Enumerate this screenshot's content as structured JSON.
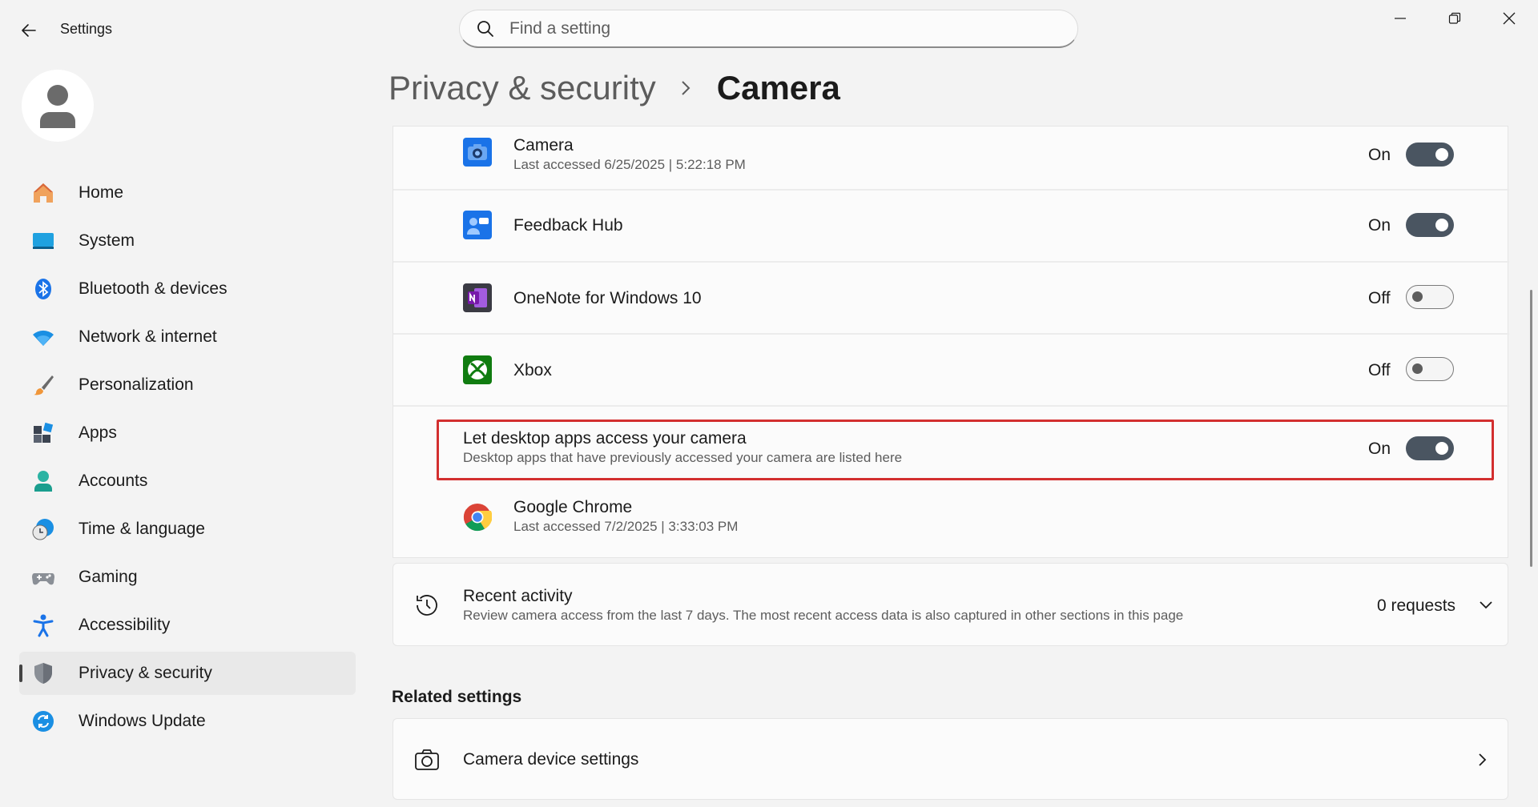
{
  "window": {
    "title": "Settings"
  },
  "search": {
    "placeholder": "Find a setting"
  },
  "sidebar": {
    "items": [
      {
        "label": "Home",
        "icon": "home-icon"
      },
      {
        "label": "System",
        "icon": "system-icon"
      },
      {
        "label": "Bluetooth & devices",
        "icon": "bluetooth-icon"
      },
      {
        "label": "Network & internet",
        "icon": "wifi-icon"
      },
      {
        "label": "Personalization",
        "icon": "brush-icon"
      },
      {
        "label": "Apps",
        "icon": "apps-icon"
      },
      {
        "label": "Accounts",
        "icon": "accounts-icon"
      },
      {
        "label": "Time & language",
        "icon": "clock-globe-icon"
      },
      {
        "label": "Gaming",
        "icon": "gamepad-icon"
      },
      {
        "label": "Accessibility",
        "icon": "accessibility-icon"
      },
      {
        "label": "Privacy & security",
        "icon": "shield-icon",
        "selected": true
      },
      {
        "label": "Windows Update",
        "icon": "update-icon"
      }
    ]
  },
  "breadcrumb": {
    "parent": "Privacy & security",
    "current": "Camera"
  },
  "apps": {
    "camera": {
      "name": "Camera",
      "last_accessed": "Last accessed 6/25/2025  |  5:22:18 PM",
      "state": "On"
    },
    "feedback_hub": {
      "name": "Feedback Hub",
      "state": "On"
    },
    "onenote": {
      "name": "OneNote for Windows 10",
      "state": "Off"
    },
    "xbox": {
      "name": "Xbox",
      "state": "Off"
    }
  },
  "desktop_apps": {
    "title": "Let desktop apps access your camera",
    "description": "Desktop apps that have previously accessed your camera are listed here",
    "state": "On",
    "chrome": {
      "name": "Google Chrome",
      "last_accessed": "Last accessed 7/2/2025  |  3:33:03 PM"
    }
  },
  "recent_activity": {
    "title": "Recent activity",
    "description": "Review camera access from the last 7 days. The most recent access data is also captured in other sections in this page",
    "count": "0 requests"
  },
  "related_settings": {
    "heading": "Related settings",
    "camera_device_settings": "Camera device settings"
  },
  "colors": {
    "accent_toggle": "#4a5561",
    "highlight_border": "#d32f2f",
    "background": "#f3f3f3"
  }
}
